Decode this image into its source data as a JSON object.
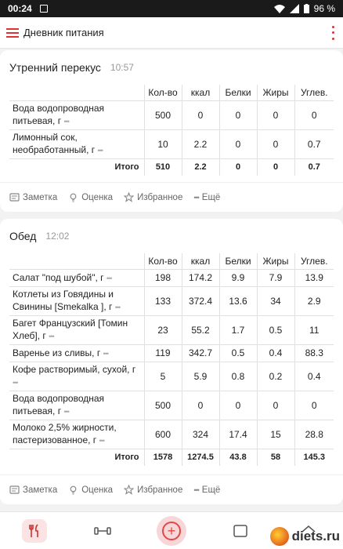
{
  "status": {
    "time": "00:24",
    "battery": "96 %"
  },
  "app": {
    "title": "Дневник питания"
  },
  "columns": [
    "Кол-во",
    "ккал",
    "Белки",
    "Жиры",
    "Углев."
  ],
  "meals": [
    {
      "name": "Утренний перекус",
      "time": "10:57",
      "items": [
        {
          "name": "Вода водопроводная питьевая, г",
          "qty": "500",
          "kcal": "0",
          "protein": "0",
          "fat": "0",
          "carbs": "0"
        },
        {
          "name": "Лимонный сок, необработанный, г",
          "qty": "10",
          "kcal": "2.2",
          "protein": "0",
          "fat": "0",
          "carbs": "0.7"
        }
      ],
      "total": {
        "label": "Итого",
        "qty": "510",
        "kcal": "2.2",
        "protein": "0",
        "fat": "0",
        "carbs": "0.7"
      }
    },
    {
      "name": "Обед",
      "time": "12:02",
      "items": [
        {
          "name": "Салат \"под шубой\", г",
          "qty": "198",
          "kcal": "174.2",
          "protein": "9.9",
          "fat": "7.9",
          "carbs": "13.9"
        },
        {
          "name": "Котлеты из Говядины и Свинины [Smekalka ], г",
          "qty": "133",
          "kcal": "372.4",
          "protein": "13.6",
          "fat": "34",
          "carbs": "2.9"
        },
        {
          "name": "Багет Французский [Томин Хлеб], г",
          "qty": "23",
          "kcal": "55.2",
          "protein": "1.7",
          "fat": "0.5",
          "carbs": "11"
        },
        {
          "name": "Варенье из сливы, г",
          "qty": "119",
          "kcal": "342.7",
          "protein": "0.5",
          "fat": "0.4",
          "carbs": "88.3"
        },
        {
          "name": "Кофе растворимый, сухой, г",
          "qty": "5",
          "kcal": "5.9",
          "protein": "0.8",
          "fat": "0.2",
          "carbs": "0.4"
        },
        {
          "name": "Вода водопроводная питьевая, г",
          "qty": "500",
          "kcal": "0",
          "protein": "0",
          "fat": "0",
          "carbs": "0"
        },
        {
          "name": "Молоко 2,5% жирности, пастеризованное, г",
          "qty": "600",
          "kcal": "324",
          "protein": "17.4",
          "fat": "15",
          "carbs": "28.8"
        }
      ],
      "total": {
        "label": "Итого",
        "qty": "1578",
        "kcal": "1274.5",
        "protein": "43.8",
        "fat": "58",
        "carbs": "145.3"
      }
    }
  ],
  "actions": {
    "note": "Заметка",
    "rating": "Оценка",
    "favorite": "Избранное",
    "more": "Ещё"
  },
  "more_dots": "•••",
  "nav": {
    "diary_icon": "fork-knife-icon",
    "fitness_icon": "dumbbell-icon",
    "add_icon": "plus-circle-icon"
  },
  "watermark": "diets.ru",
  "colors": {
    "accent": "#e04848"
  }
}
